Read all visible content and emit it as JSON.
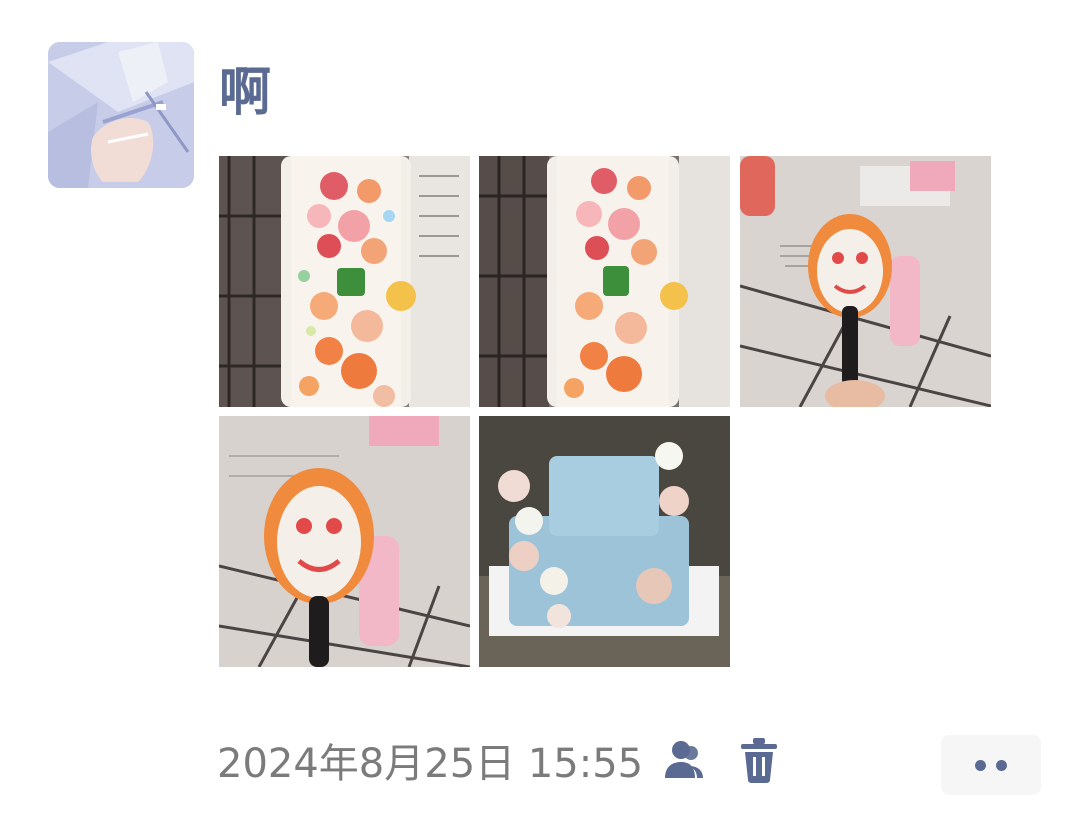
{
  "post": {
    "author": "啊",
    "timestamp": "2024年8月25日 15:55",
    "photos": [
      {
        "icon": "phone-case-cream-decoration-photo"
      },
      {
        "icon": "phone-case-cream-decoration-photo"
      },
      {
        "icon": "spoon-smiley-face-photo"
      },
      {
        "icon": "spoon-smiley-face-photo"
      },
      {
        "icon": "moon-cake-with-roses-photo"
      }
    ],
    "icons": {
      "privacy": "people-icon",
      "delete": "trash-icon",
      "more": "more-dots-icon"
    }
  },
  "colors": {
    "author_name": "#5b6a92",
    "timestamp": "#7b7b7b",
    "icon_accent": "#5b6a92",
    "more_button_bg": "#f6f6f6"
  }
}
